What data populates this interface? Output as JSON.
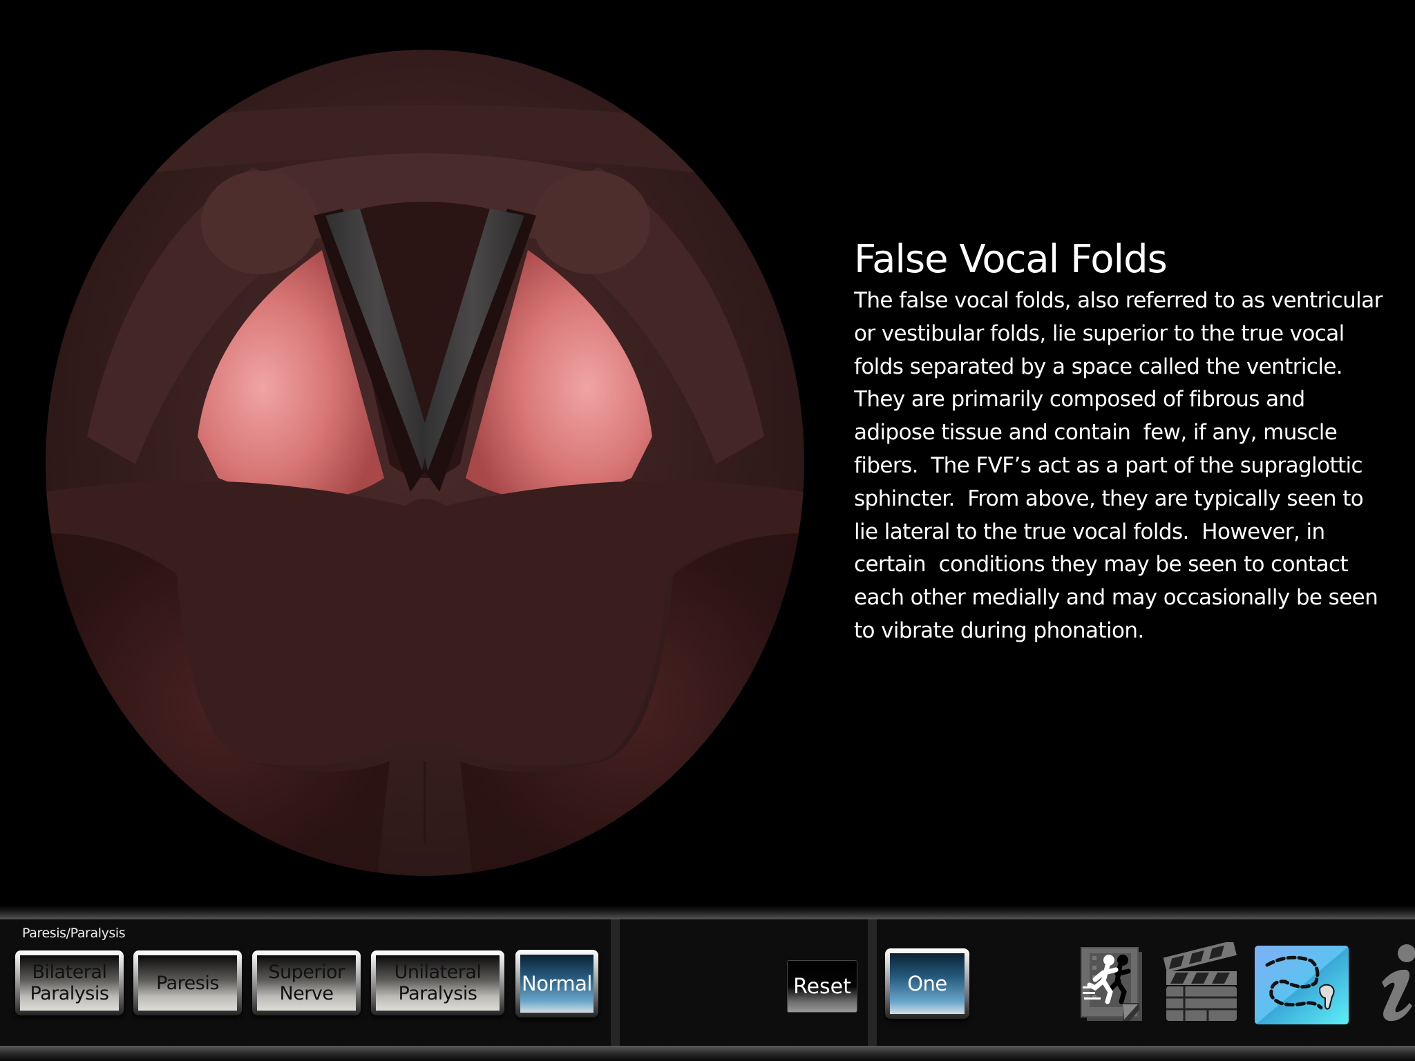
{
  "illustration": {
    "subject": "laryngoscopic view of larynx with false vocal folds highlighted",
    "highlight_color": "#e8888a"
  },
  "info": {
    "title": "False Vocal Folds",
    "body": "The false vocal folds, also referred to as ventricular\nor vestibular folds, lie superior to the true vocal\nfolds separated by a space called the ventricle.\nThey are primarily composed of fibrous and\nadipose tissue and contain  few, if any, muscle\nfibers.  The FVF’s act as a part of the supraglottic\nsphincter.  From above, they are typically seen to\nlie lateral to the true vocal folds.  However, in\ncertain  conditions they may be seen to contact\neach other medially and may occasionally be seen\nto vibrate during phonation."
  },
  "toolbar": {
    "group_label": "Paresis/Paralysis",
    "condition_buttons": [
      {
        "label": "Bilateral\nParalysis",
        "active": false
      },
      {
        "label": "Paresis",
        "active": false
      },
      {
        "label": "Superior\nNerve",
        "active": false
      },
      {
        "label": "Unilateral\nParalysis",
        "active": false
      },
      {
        "label": "Normal",
        "active": true
      }
    ],
    "reset_label": "Reset",
    "mode_button": {
      "label": "One",
      "active": true
    },
    "icons": [
      {
        "name": "animation-icon",
        "active": false
      },
      {
        "name": "video-clapperboard-icon",
        "active": false
      },
      {
        "name": "trace-path-icon",
        "active": true
      },
      {
        "name": "info-icon",
        "active": false
      }
    ],
    "colors": {
      "active_blue": "#3a7fb0",
      "trace_active_bg": "#5ec0ee"
    }
  }
}
